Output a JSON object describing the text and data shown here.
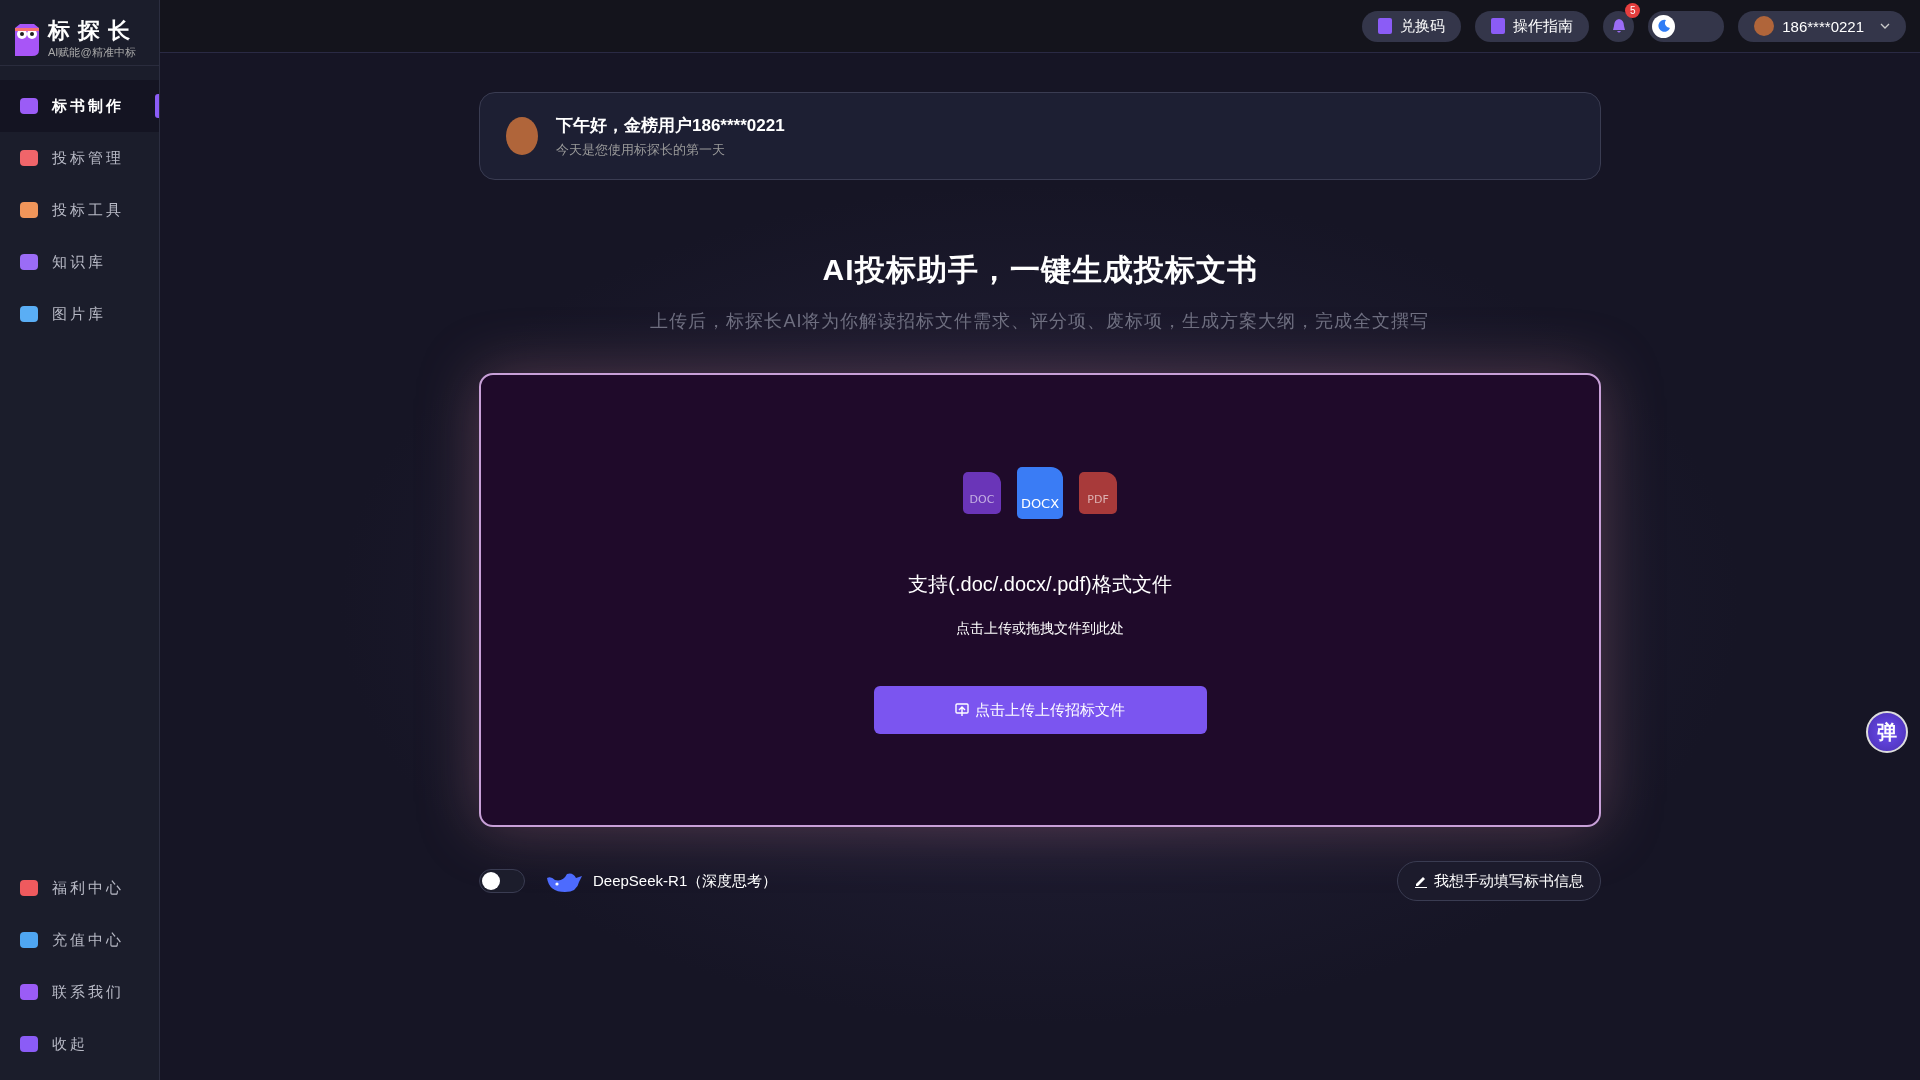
{
  "logo": {
    "title": "标探长",
    "tagline": "AI赋能@精准中标"
  },
  "sidebar": {
    "items": [
      {
        "label": "标书制作",
        "selected": true,
        "color": "#9b5cf6"
      },
      {
        "label": "投标管理",
        "selected": false,
        "color": "#f0656a"
      },
      {
        "label": "投标工具",
        "selected": false,
        "color": "#f0955a"
      },
      {
        "label": "知识库",
        "selected": false,
        "color": "#9b6cf6"
      },
      {
        "label": "图片库",
        "selected": false,
        "color": "#5aaef5"
      }
    ],
    "bottom_items": [
      {
        "label": "福利中心",
        "color": "#ef5a5e"
      },
      {
        "label": "充值中心",
        "color": "#4fa6f2"
      },
      {
        "label": "联系我们",
        "color": "#9b5cf6"
      },
      {
        "label": "收起",
        "color": "#8b5cf6"
      }
    ]
  },
  "top_bar": {
    "buttons": [
      "兑换码",
      "操作指南"
    ],
    "notification_count": "5",
    "theme_switch": {
      "on": false
    },
    "user": "186****0221"
  },
  "greeting": {
    "title": "下午好，金榜用户186****0221",
    "subtitle": "今天是您使用标探长的第一天"
  },
  "hero": {
    "title": "AI投标助手，一键生成投标文书",
    "subtitle": "上传后，标探长AI将为你解读招标文件需求、评分项、废标项，生成方案大纲，完成全文撰写"
  },
  "upload": {
    "file_types": [
      {
        "label": "DOC",
        "color": "#6a35b8"
      },
      {
        "label": "DOCX",
        "color": "#3a7cf5"
      },
      {
        "label": "PDF",
        "color": "#a83a3a"
      }
    ],
    "formats": "支持(.doc/.docx/.pdf)格式文件",
    "hint": "点击上传或拖拽文件到此处",
    "button": "点击上传上传招标文件"
  },
  "options": {
    "deep_think": {
      "on": false,
      "label": "DeepSeek-R1（深度思考）"
    },
    "manual_button": "我想手动填写标书信息"
  },
  "float_button": "弹"
}
